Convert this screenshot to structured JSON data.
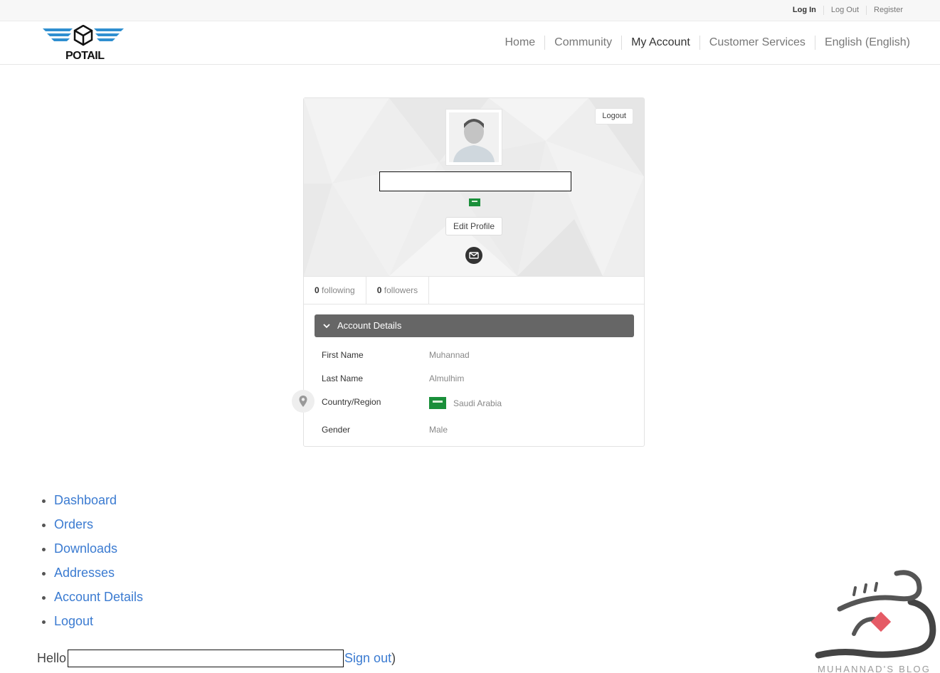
{
  "topbar": {
    "links": [
      "Log In",
      "Log Out",
      "Register"
    ]
  },
  "header": {
    "logo_text": "POTAIL",
    "nav": [
      "Home",
      "Community",
      "My Account",
      "Customer Services",
      "English (English)"
    ]
  },
  "profile": {
    "logout_label": "Logout",
    "edit_profile_label": "Edit Profile",
    "following_count": "0",
    "following_label": "following",
    "followers_count": "0",
    "followers_label": "followers"
  },
  "account_details": {
    "heading": "Account Details",
    "rows": [
      {
        "label": "First Name",
        "value": "Muhannad"
      },
      {
        "label": "Last Name",
        "value": "Almulhim"
      },
      {
        "label": "Country/Region",
        "value": "Saudi Arabia"
      },
      {
        "label": "Gender",
        "value": "Male"
      }
    ]
  },
  "account_menu": [
    "Dashboard",
    "Orders",
    "Downloads",
    "Addresses",
    "Account Details",
    "Logout"
  ],
  "greeting": {
    "hello": "Hello",
    "signout": "Sign out",
    "paren_close": ")"
  },
  "watermark": {
    "caption": "MUHANNAD'S BLOG"
  },
  "colors": {
    "link": "#3b7bd1",
    "details_header": "#666666",
    "flag_green": "#1a8f3a"
  },
  "icons": [
    "logo-box-icon",
    "avatar-silhouette-icon",
    "saudi-flag-icon",
    "envelope-icon",
    "chevron-down-icon",
    "map-pin-icon"
  ]
}
